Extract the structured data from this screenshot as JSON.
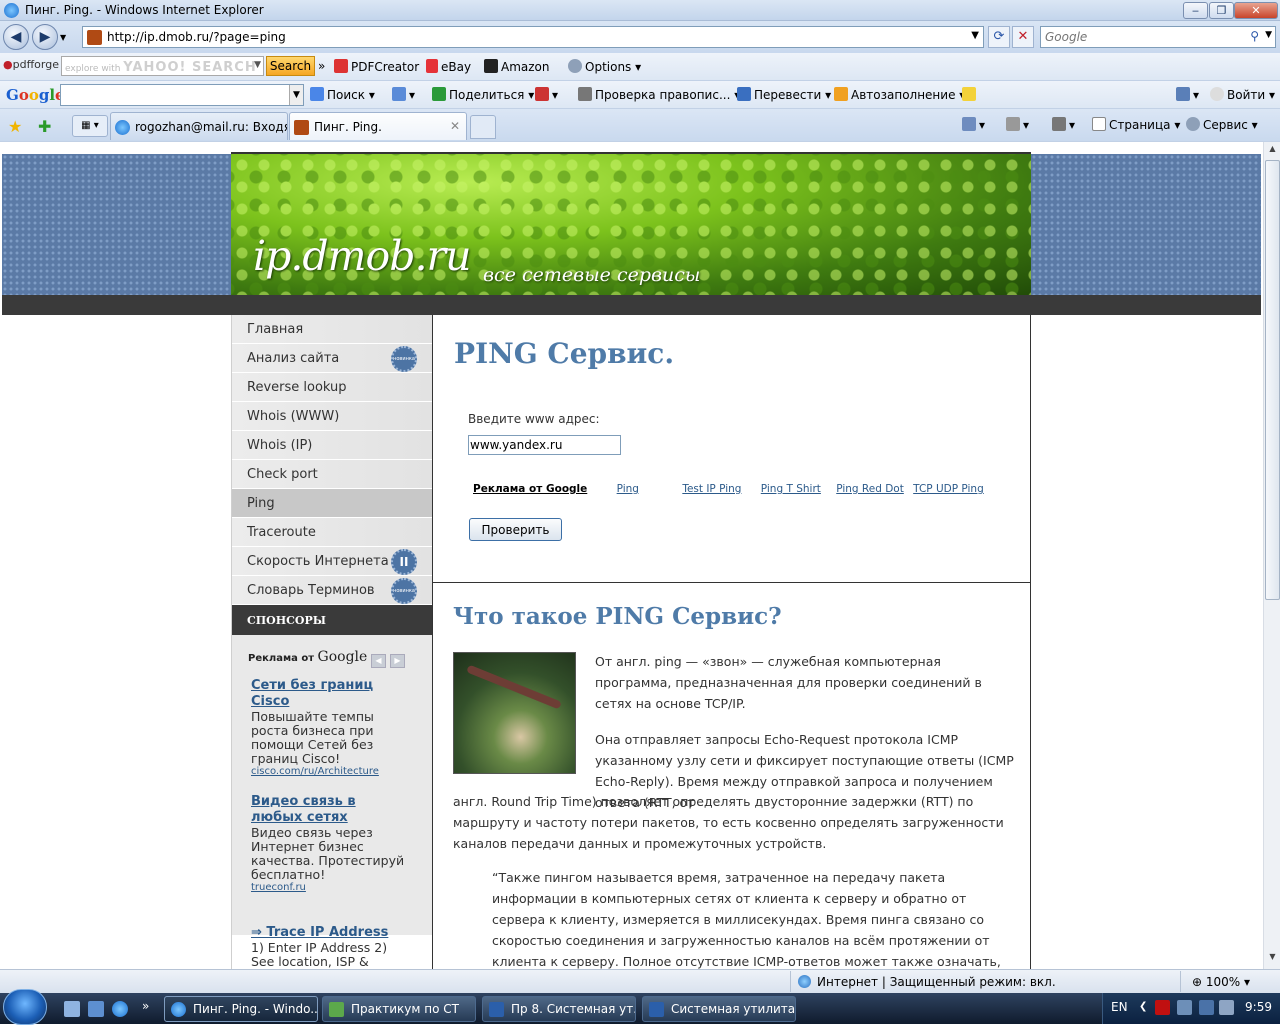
{
  "window": {
    "title": "Пинг. Ping. - Windows Internet Explorer",
    "min": "‒",
    "max": "❐",
    "close": "✕"
  },
  "address": {
    "url": "http://ip.dmob.ru/?page=ping",
    "search_placeholder": "Google"
  },
  "toolbar1": {
    "pdfforge": "pdfforge",
    "yahoo_hint": "explore with",
    "yahoo_logo": "YAHOO! SEARCH",
    "search_btn": "Search",
    "pdfcreator": "PDFCreator",
    "ebay": "eBay",
    "amazon": "Amazon",
    "options": "Options"
  },
  "toolbar2": {
    "google_logo": "Google",
    "poisk": "Поиск",
    "share": "Поделиться",
    "spell": "Проверка правопис...",
    "translate": "Перевести",
    "autofill": "Автозаполнение",
    "login": "Войти"
  },
  "tabs": {
    "tab1": "rogozhan@mail.ru: Входя...",
    "tab2": "Пинг. Ping.",
    "page_menu": "Страница",
    "tools_menu": "Сервис"
  },
  "site": {
    "name": "ip.dmob.ru",
    "tagline": "все сетевые сервисы"
  },
  "sidebar": {
    "items": [
      {
        "label": "Главная",
        "badge": ""
      },
      {
        "label": "Анализ сайта",
        "badge": "новинка"
      },
      {
        "label": "Reverse lookup",
        "badge": ""
      },
      {
        "label": "Whois (WWW)",
        "badge": ""
      },
      {
        "label": "Whois (IP)",
        "badge": ""
      },
      {
        "label": "Check port",
        "badge": ""
      },
      {
        "label": "Ping",
        "badge": ""
      },
      {
        "label": "Traceroute",
        "badge": ""
      },
      {
        "label": "Скорость Интернета",
        "badge": "II"
      },
      {
        "label": "Словарь Терминов",
        "badge": "новинка"
      }
    ],
    "sponsors": "СПОНСОРЫ",
    "ads_header_prefix": "Реклама от",
    "ads_header_brand": "Google",
    "ads": [
      {
        "title": "Сети без границ Cisco",
        "body": "Повышайте темпы роста бизнеса при помощи Сетей без границ Cisco!",
        "url": "cisco.com/ru/Architecture"
      },
      {
        "title": "Видео связь в любых сетях",
        "body": "Видео связь через Интернет бизнес качества. Протестируй бесплатно!",
        "url": "trueconf.ru"
      },
      {
        "title": "⇒ Trace IP Address",
        "body": "1) Enter IP Address 2) See location, ISP &",
        "url": ""
      }
    ]
  },
  "main": {
    "title": "PING Сервис.",
    "input_label": "Введите www адрес:",
    "input_value": "www.yandex.ru",
    "adlinks_lead": "Реклама от Google",
    "adlinks": [
      "Ping",
      "Test IP Ping",
      "Ping T Shirt",
      "Ping Red Dot",
      "TCP UDP Ping"
    ],
    "check_button": "Проверить",
    "h2": "Что такое PING Сервис?",
    "p1": "От англ. ping — «звон» — служебная компьютерная программа, предназначенная для проверки соединений в сетях на основе TCP/IP.",
    "p2a": "Она отправляет запросы Echo-Request протокола ICMP указанному узлу сети и фиксирует поступающие ответы (ICMP Echo-Reply). Время между отправкой запроса и получением ответа (RTT, от",
    "p2b": "англ. Round Trip Time) позволяет определять двусторонние задержки (RTT) по маршруту и частоту потери пакетов, то есть косвенно определять загруженности каналов передачи данных и промежуточных устройств.",
    "p3": "“Также пингом называется время, затраченное на передачу пакета информации в компьютерных сетях от клиента к серверу и обратно от сервера к клиенту, измеряется в миллисекундах. Время пинга связано со скоростью соединения и загруженностью каналов на всём протяжении от клиента к серверу. Полное отсутствие ICMP-ответов может также означать, что удалённый узел (или какой-"
  },
  "status": {
    "zone": "Интернет | Защищенный режим: вкл.",
    "zoom": "100%"
  },
  "taskbar": {
    "items": [
      "Пинг. Ping. - Windo...",
      "Практикум по СТ",
      "Пр 8. Системная ут...",
      "Системная утилита..."
    ],
    "lang": "EN",
    "clock": "9:59"
  },
  "colors": {
    "accent_title": "#4f7ba8",
    "link": "#2c5a8a",
    "pattern": "#5b7aa6"
  }
}
